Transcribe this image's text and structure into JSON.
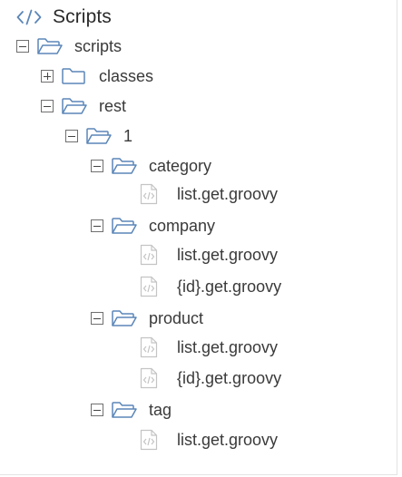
{
  "header": {
    "title": "Scripts",
    "icon": "code-brackets-icon"
  },
  "colors": {
    "folder_stroke": "#5b86b8",
    "icon_stroke": "#5b86b8",
    "file_stroke": "#c4c4c4",
    "text": "#3a3a3a"
  },
  "tree": {
    "scripts": "scripts",
    "classes": "classes",
    "rest": "rest",
    "v1": "1",
    "category": {
      "label": "category",
      "files": [
        "list.get.groovy"
      ]
    },
    "company": {
      "label": "company",
      "files": [
        "list.get.groovy",
        "{id}.get.groovy"
      ]
    },
    "product": {
      "label": "product",
      "files": [
        "list.get.groovy",
        "{id}.get.groovy"
      ]
    },
    "tag": {
      "label": "tag",
      "files": [
        "list.get.groovy"
      ]
    }
  }
}
